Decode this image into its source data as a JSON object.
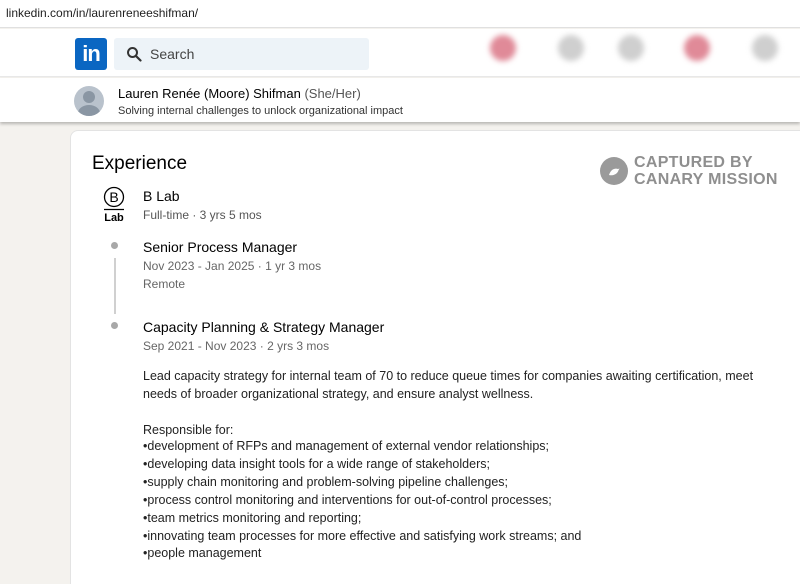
{
  "browser": {
    "url": "linkedin.com/in/laurenreneeshifman/"
  },
  "nav": {
    "logo_text": "in",
    "search_placeholder": "Search"
  },
  "profile": {
    "name": "Lauren Renée (Moore) Shifman",
    "pronouns": "(She/Her)",
    "headline": "Solving internal challenges to unlock organizational impact"
  },
  "section": {
    "title": "Experience"
  },
  "watermark": {
    "line1": "CAPTURED BY",
    "line2": "CANARY MISSION"
  },
  "company": {
    "logo_letter": "B",
    "logo_word": "Lab",
    "name": "B Lab",
    "summary": "Full-time · 3 yrs 5 mos"
  },
  "roles": [
    {
      "title": "Senior Process Manager",
      "dates": "Nov 2023 - Jan 2025 · 1 yr 3 mos",
      "location": "Remote"
    },
    {
      "title": "Capacity Planning & Strategy Manager",
      "dates": "Sep 2021 - Nov 2023 · 2 yrs 3 mos",
      "description_line1": "Lead capacity strategy for internal team of 70 to reduce queue times for companies awaiting certification, meet",
      "description_line2": "needs of broader organizational strategy, and ensure analyst wellness.",
      "responsible_heading": "Responsible for:",
      "responsibilities": [
        "•development of RFPs and management of external vendor relationships;",
        "•developing data insight tools for a wide range of stakeholders;",
        "•supply chain monitoring and problem-solving pipeline challenges;",
        "•process control monitoring and interventions for out-of-control processes;",
        "•team metrics monitoring and reporting;",
        "•innovating team processes for more effective and satisfying work streams; and",
        "•people management"
      ]
    }
  ],
  "colors": {
    "linkedin_blue": "#0a66c2",
    "search_bg": "#edf3f8",
    "page_bg": "#f4f2ee"
  }
}
